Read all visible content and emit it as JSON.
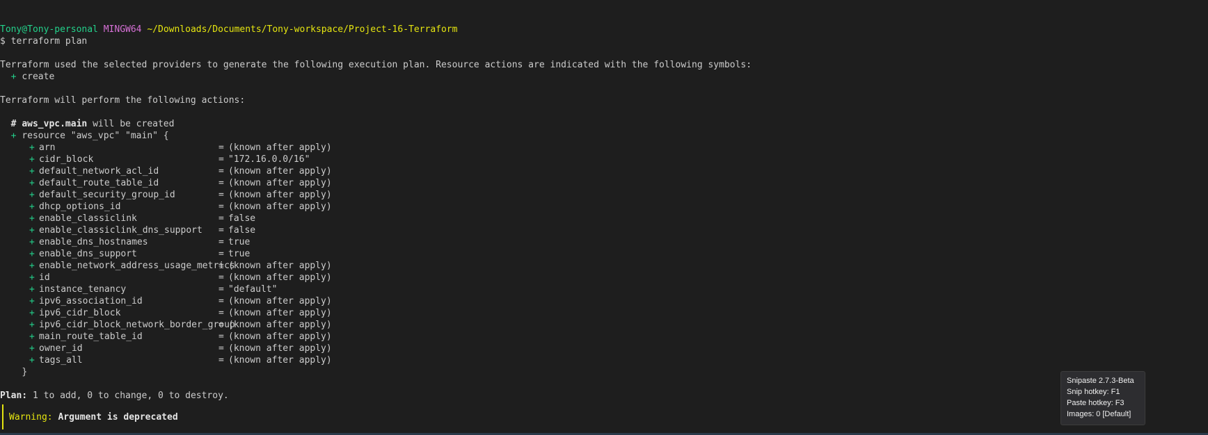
{
  "prompt": {
    "user_host": "Tony@Tony-personal",
    "shell": "MINGW64",
    "path": "~/Downloads/Documents/Tony-workspace/Project-16-Terraform",
    "symbol": "$",
    "command": "terraform plan"
  },
  "intro": {
    "line1": "Terraform used the selected providers to generate the following execution plan. Resource actions are indicated with the following symbols:",
    "create_symbol": "+",
    "create_label": "create",
    "actions_line": "Terraform will perform the following actions:"
  },
  "resource": {
    "comment_hash": "#",
    "comment_name": "aws_vpc.main",
    "comment_suffix": "will be created",
    "header_plus": "+",
    "header_text": "resource \"aws_vpc\" \"main\" {",
    "close_brace": "}",
    "attributes": [
      {
        "name": "arn",
        "value": "(known after apply)"
      },
      {
        "name": "cidr_block",
        "value": "\"172.16.0.0/16\""
      },
      {
        "name": "default_network_acl_id",
        "value": "(known after apply)"
      },
      {
        "name": "default_route_table_id",
        "value": "(known after apply)"
      },
      {
        "name": "default_security_group_id",
        "value": "(known after apply)"
      },
      {
        "name": "dhcp_options_id",
        "value": "(known after apply)"
      },
      {
        "name": "enable_classiclink",
        "value": "false"
      },
      {
        "name": "enable_classiclink_dns_support",
        "value": "false"
      },
      {
        "name": "enable_dns_hostnames",
        "value": "true"
      },
      {
        "name": "enable_dns_support",
        "value": "true"
      },
      {
        "name": "enable_network_address_usage_metrics",
        "value": "(known after apply)"
      },
      {
        "name": "id",
        "value": "(known after apply)"
      },
      {
        "name": "instance_tenancy",
        "value": "\"default\""
      },
      {
        "name": "ipv6_association_id",
        "value": "(known after apply)"
      },
      {
        "name": "ipv6_cidr_block",
        "value": "(known after apply)"
      },
      {
        "name": "ipv6_cidr_block_network_border_group",
        "value": "(known after apply)"
      },
      {
        "name": "main_route_table_id",
        "value": "(known after apply)"
      },
      {
        "name": "owner_id",
        "value": "(known after apply)"
      },
      {
        "name": "tags_all",
        "value": "(known after apply)"
      }
    ]
  },
  "plan": {
    "label": "Plan:",
    "summary": "1 to add, 0 to change, 0 to destroy."
  },
  "warning": {
    "label": "Warning:",
    "text": "Argument is deprecated"
  },
  "tooltip": {
    "line1": "Snipaste 2.7.3-Beta",
    "line2": "Snip hotkey: F1",
    "line3": "Paste hotkey: F3",
    "line4": "Images: 0 [Default]"
  },
  "colors": {
    "background": "#1e1e1e",
    "green": "#23d18b",
    "magenta": "#d670d6",
    "yellow": "#e5e510",
    "text": "#cccccc"
  }
}
